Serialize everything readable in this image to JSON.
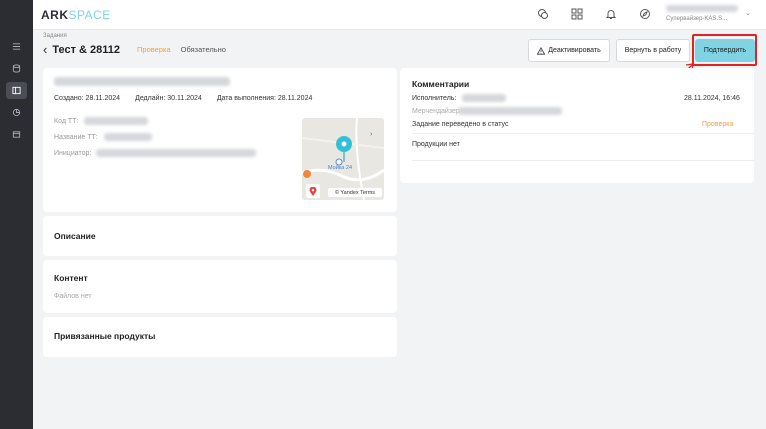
{
  "app": {
    "logo_main": "ARK",
    "logo_accent": "SPACE"
  },
  "topbar": {
    "user_role": "Супервайзер-KAS.S..."
  },
  "breadcrumb": "Задания",
  "task": {
    "title": "Тест & 28112",
    "status": "Проверка",
    "required_label": "Обязательно",
    "created": "Создано: 28.11.2024",
    "deadline": "Дедлайн: 30.11.2024",
    "completed": "Дата выполнения: 28.11.2024",
    "code_label": "Код ТТ:",
    "name_label": "Название ТТ:",
    "initiator_label": "Инициатор:"
  },
  "actions": {
    "deactivate": "Деактивировать",
    "return": "Вернуть в работу",
    "confirm": "Подтвердить"
  },
  "map": {
    "place_label": "Мойка 24",
    "attribution": "© Yandex Terms"
  },
  "sections": {
    "description": "Описание",
    "content": "Контент",
    "no_files": "Файлов нет",
    "linked_products": "Привязанные продукты"
  },
  "comments": {
    "title": "Комментарии",
    "executor_label": "Исполнитель:",
    "timestamp": "28.11.2024, 16:46",
    "merch_label": "Мерчендайзер",
    "status_change_text": "Задание переведено в статус",
    "status_change_value": "Проверка",
    "no_products": "Продукции нет"
  },
  "colors": {
    "accent": "#7fd3e3",
    "status": "#f0a13a",
    "highlight": "#e02424",
    "sidebar": "#2b2d33"
  }
}
